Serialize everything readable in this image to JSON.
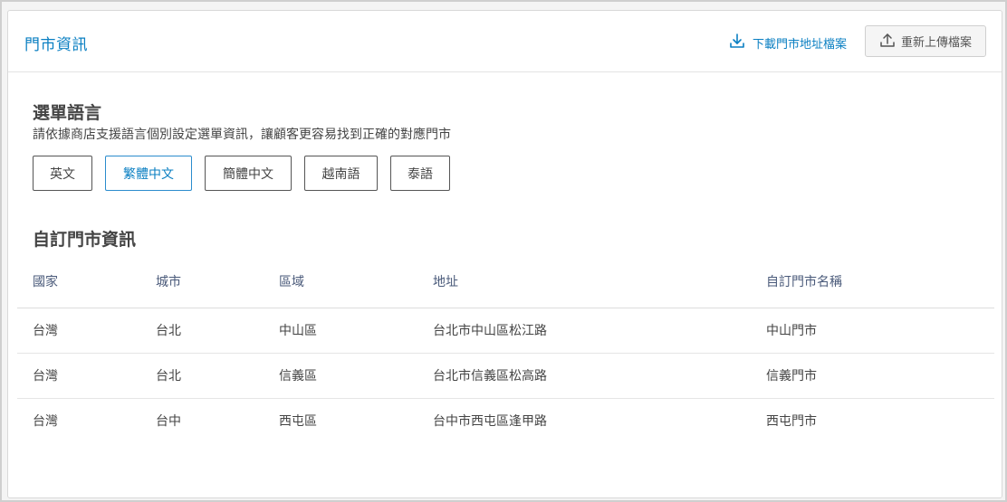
{
  "header": {
    "title": "門市資訊",
    "download_label": "下載門市地址檔案",
    "upload_label": "重新上傳檔案"
  },
  "menu_language": {
    "title": "選單語言",
    "description": "請依據商店支援語言個別設定選單資訊，讓顧客更容易找到正確的對應門市",
    "languages": [
      {
        "label": "英文",
        "active": false
      },
      {
        "label": "繁體中文",
        "active": true
      },
      {
        "label": "簡體中文",
        "active": false
      },
      {
        "label": "越南語",
        "active": false
      },
      {
        "label": "泰語",
        "active": false
      }
    ]
  },
  "custom_store": {
    "title": "自訂門市資訊",
    "columns": [
      "國家",
      "城市",
      "區域",
      "地址",
      "自訂門市名稱"
    ],
    "rows": [
      [
        "台灣",
        "台北",
        "中山區",
        "台北市中山區松江路",
        "中山門市"
      ],
      [
        "台灣",
        "台北",
        "信義區",
        "台北市信義區松高路",
        "信義門市"
      ],
      [
        "台灣",
        "台中",
        "西屯區",
        "台中市西屯區逢甲路",
        "西屯門市"
      ]
    ]
  },
  "colors": {
    "accent": "#0a7fc2",
    "header_text": "#4a5a7a"
  },
  "icons": {
    "download": "download-icon",
    "upload": "upload-icon"
  }
}
